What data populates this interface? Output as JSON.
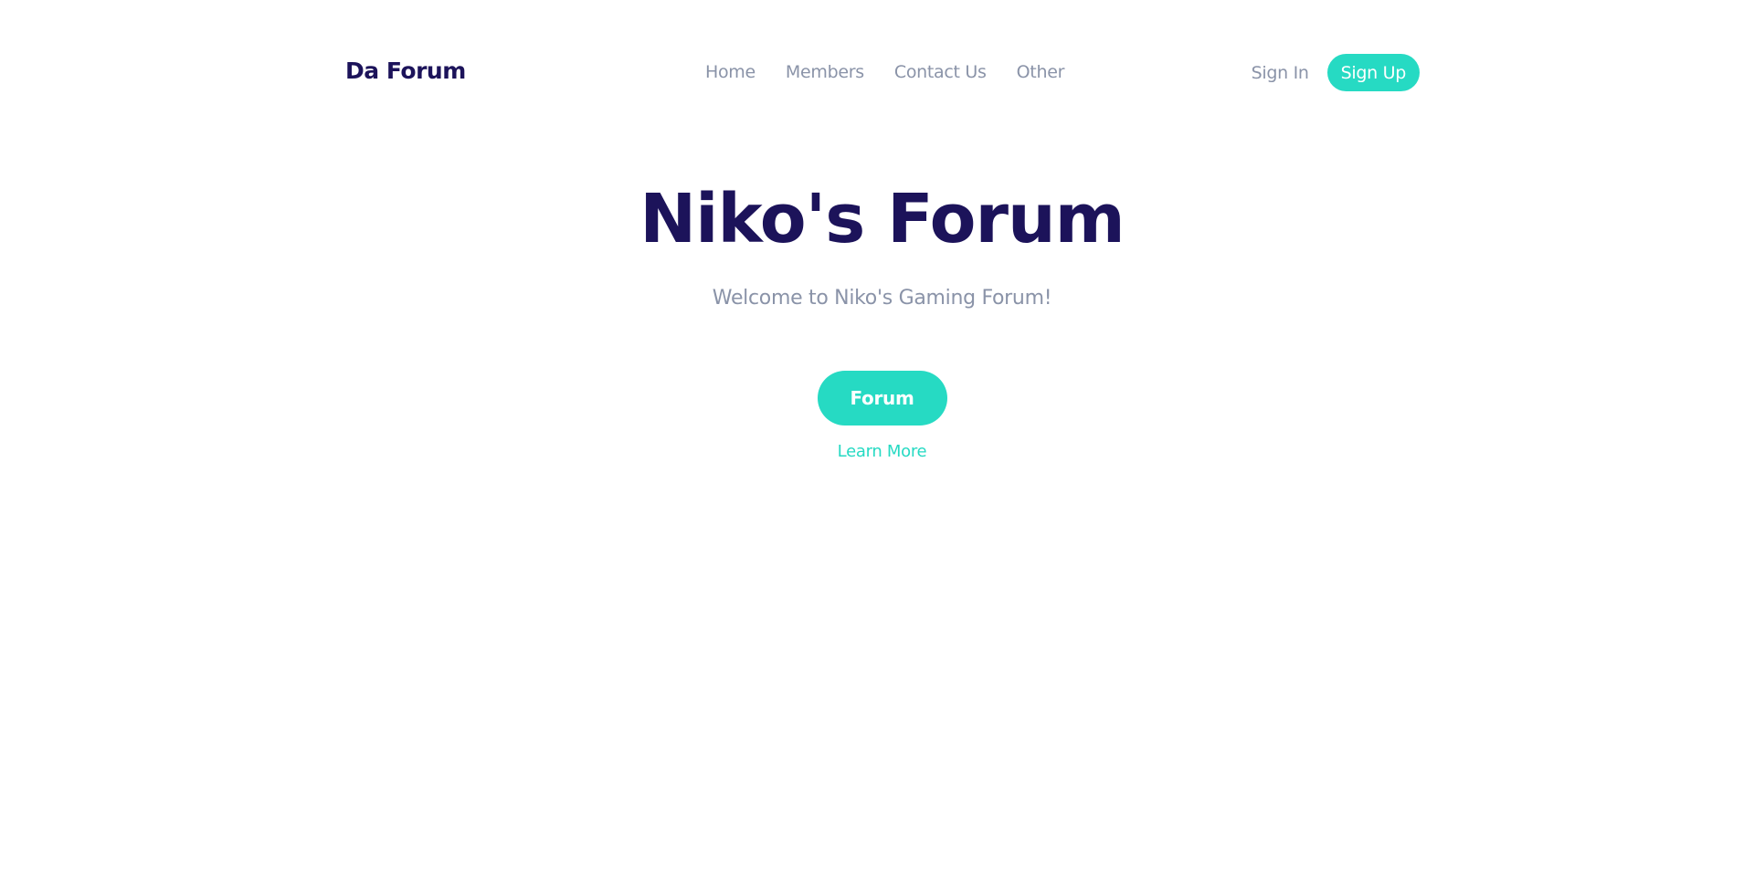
{
  "header": {
    "brand": "Da Forum",
    "nav": [
      {
        "label": "Home"
      },
      {
        "label": "Members"
      },
      {
        "label": "Contact Us"
      },
      {
        "label": "Other"
      }
    ],
    "sign_in": "Sign In",
    "sign_up": "Sign Up"
  },
  "hero": {
    "title": "Niko's Forum",
    "subtitle": "Welcome to Niko's Gaming Forum!",
    "forum_button": "Forum",
    "learn_more": "Learn More"
  },
  "colors": {
    "brand": "#1c135a",
    "accent": "#26dac3",
    "muted": "#8a93a8"
  }
}
